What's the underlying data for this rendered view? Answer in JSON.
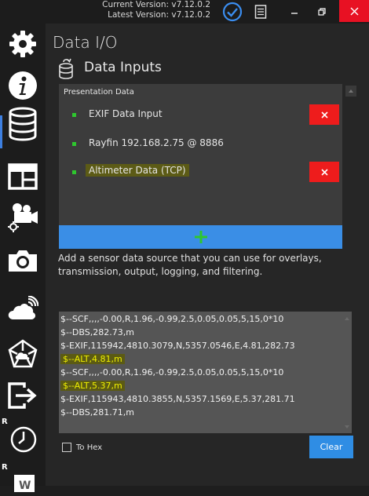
{
  "titlebar": {
    "current_version": "Current Version: v7.12.0.2",
    "latest_version": "Latest Version: v7.12.0.2",
    "icons": [
      "update-check-icon",
      "document-icon",
      "minimize-icon",
      "restore-icon",
      "close-icon"
    ]
  },
  "sidebar": {
    "items": [
      {
        "icon": "gear-icon"
      },
      {
        "icon": "info-icon"
      },
      {
        "icon": "database-icon",
        "active": true
      },
      {
        "icon": "layout-icon"
      },
      {
        "icon": "video-camera-settings-icon"
      },
      {
        "icon": "camera-icon"
      },
      {
        "icon": "cloud-broadcast-icon"
      },
      {
        "icon": "network-cloud-icon"
      },
      {
        "icon": "export-icon"
      },
      {
        "icon": "clock-icon",
        "badge": "R"
      },
      {
        "icon": "word-doc-icon",
        "badge": "R"
      }
    ],
    "accent": "#3d7fe0"
  },
  "main": {
    "title": "Data I/O",
    "section_title": "Data Inputs",
    "panel_label": "Presentation Data",
    "inputs": [
      {
        "label": "EXIF Data Input",
        "removable": true,
        "highlighted": false
      },
      {
        "label": "Rayfin 192.168.2.75 @ 8886",
        "removable": false,
        "highlighted": false
      },
      {
        "label": "Altimeter Data (TCP)",
        "removable": true,
        "highlighted": true
      }
    ],
    "remove_symbol": "✕",
    "add_symbol": "+",
    "description": "Add a sensor data source that you can use for overlays, transmission, output, logging, and filtering.",
    "console_lines": [
      {
        "text": "$--SCF,,,,-0.00,R,1.96,-0.99,2.5,0.05,0.05,5,15,0*10",
        "hl": false
      },
      {
        "text": "$--DBS,282.73,m",
        "hl": false
      },
      {
        "text": "$-EXIF,115942,4810.3079,N,5357.0546,E,4.81,282.73",
        "hl": false
      },
      {
        "text": "$--ALT,4.81,m",
        "hl": true
      },
      {
        "text": "$--SCF,,,,-0.00,R,1.96,-0.99,2.5,0.05,0.05,5,15,0*10",
        "hl": false
      },
      {
        "text": "$--ALT,5.37,m",
        "hl": true
      },
      {
        "text": "$-EXIF,115943,4810.3855,N,5357.1569,E,5.37,281.71",
        "hl": false
      },
      {
        "text": "$--DBS,281.71,m",
        "hl": false
      }
    ],
    "to_hex_label": "To Hex",
    "to_hex_checked": false,
    "clear_label": "Clear"
  },
  "colors": {
    "add_button": "#3a8ee6",
    "remove_button": "#ee1c1c",
    "status_dot": "#2ec72e",
    "highlight_text": "#f0f000"
  }
}
